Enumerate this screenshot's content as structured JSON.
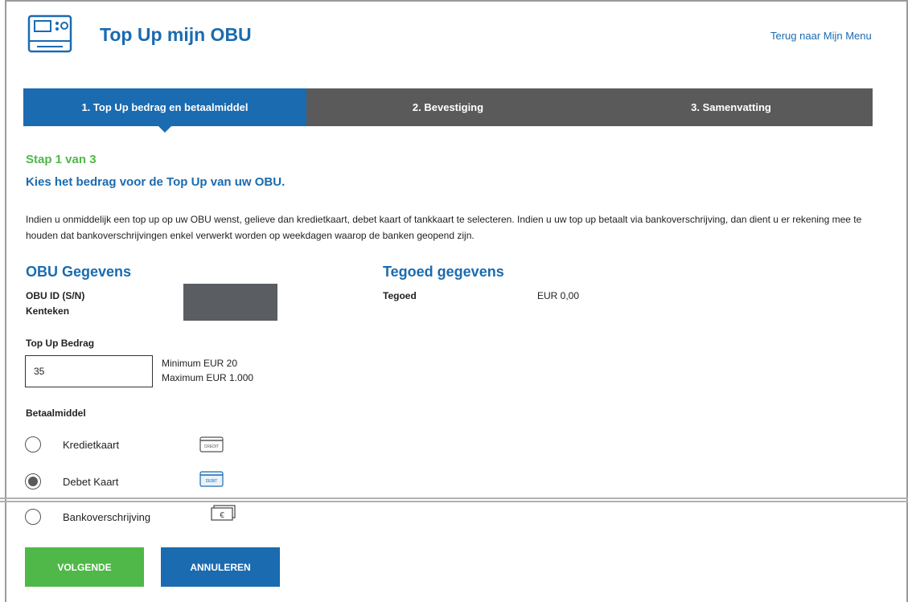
{
  "header": {
    "title": "Top Up mijn OBU",
    "back_link": "Terug naar Mijn Menu"
  },
  "steps": [
    {
      "label": "1. Top Up bedrag en betaalmiddel",
      "active": true
    },
    {
      "label": "2. Bevestiging",
      "active": false
    },
    {
      "label": "3. Samenvatting",
      "active": false
    }
  ],
  "content": {
    "step_count": "Stap 1 van 3",
    "heading": "Kies het bedrag voor de Top Up van uw OBU.",
    "intro": "Indien u onmiddelijk een top up op uw OBU wenst, gelieve dan kredietkaart, debet kaart of tankkaart te selecteren. Indien u uw top up betaalt via bankoverschrijving, dan dient u er rekening mee te houden dat bankoverschrijvingen enkel verwerkt worden op weekdagen waarop de banken geopend zijn."
  },
  "obu": {
    "heading": "OBU Gegevens",
    "id_label": "OBU ID (S/N)",
    "plate_label": "Kenteken"
  },
  "balance": {
    "heading": "Tegoed gegevens",
    "label": "Tegoed",
    "value": "EUR 0,00"
  },
  "topup": {
    "label": "Top Up Bedrag",
    "value": "35",
    "minimum": "Minimum EUR 20",
    "maximum": "Maximum EUR 1.000"
  },
  "payment": {
    "label": "Betaalmiddel",
    "options": [
      {
        "label": "Kredietkaart",
        "icon": "credit-card-icon",
        "icon_text": "CREDIT",
        "selected": false
      },
      {
        "label": "Debet Kaart",
        "icon": "debit-card-icon",
        "icon_text": "DEBIT",
        "selected": true
      },
      {
        "label": "Bankoverschrijving",
        "icon": "euro-banknote-icon",
        "icon_text": "€",
        "selected": false
      }
    ]
  },
  "buttons": {
    "next": "VOLGENDE",
    "cancel": "ANNULEREN"
  },
  "colors": {
    "primary": "#1a6bb0",
    "success": "#4fb848",
    "step_inactive": "#5a5a5a"
  }
}
